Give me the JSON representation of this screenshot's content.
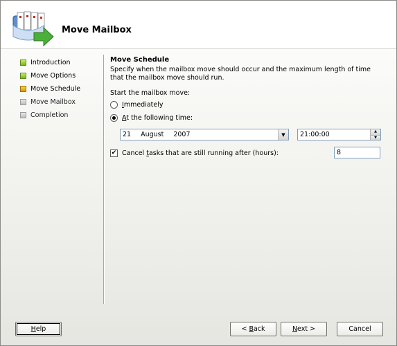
{
  "header": {
    "title": "Move Mailbox",
    "icon": "mailbox-move-icon"
  },
  "steps": [
    {
      "label": "Introduction",
      "state": "done"
    },
    {
      "label": "Move Options",
      "state": "done"
    },
    {
      "label": "Move Schedule",
      "state": "current"
    },
    {
      "label": "Move Mailbox",
      "state": "pending"
    },
    {
      "label": "Completion",
      "state": "pending"
    }
  ],
  "content": {
    "title": "Move Schedule",
    "description": "Specify when the mailbox move should occur and the maximum length of time that the mailbox move should run.",
    "start_label": "Start the mailbox move:",
    "radio_immediately": {
      "access_key": "I",
      "rest": "mmediately",
      "selected": false
    },
    "radio_following": {
      "access_key": "A",
      "rest": "t the following time:",
      "selected": true
    },
    "date": {
      "day": "21",
      "month": "August",
      "year": "2007"
    },
    "time": "21:00:00",
    "cancel_tasks": {
      "prefix": "Cancel ",
      "access_key": "t",
      "rest": "asks that are still running after (hours):",
      "checked": true,
      "check_glyph": "✔"
    },
    "hours": "8"
  },
  "buttons": {
    "help": {
      "access_key": "H",
      "rest": "elp"
    },
    "back": {
      "prefix": "< ",
      "access_key": "B",
      "rest": "ack"
    },
    "next": {
      "access_key": "N",
      "rest": "ext >"
    },
    "cancel": "Cancel"
  },
  "glyphs": {
    "dropdown": "▼",
    "spin_up": "▲",
    "spin_down": "▼"
  },
  "colors": {
    "done": "#7ab51e",
    "current": "#d49b00",
    "pending": "#bcbcbc"
  }
}
